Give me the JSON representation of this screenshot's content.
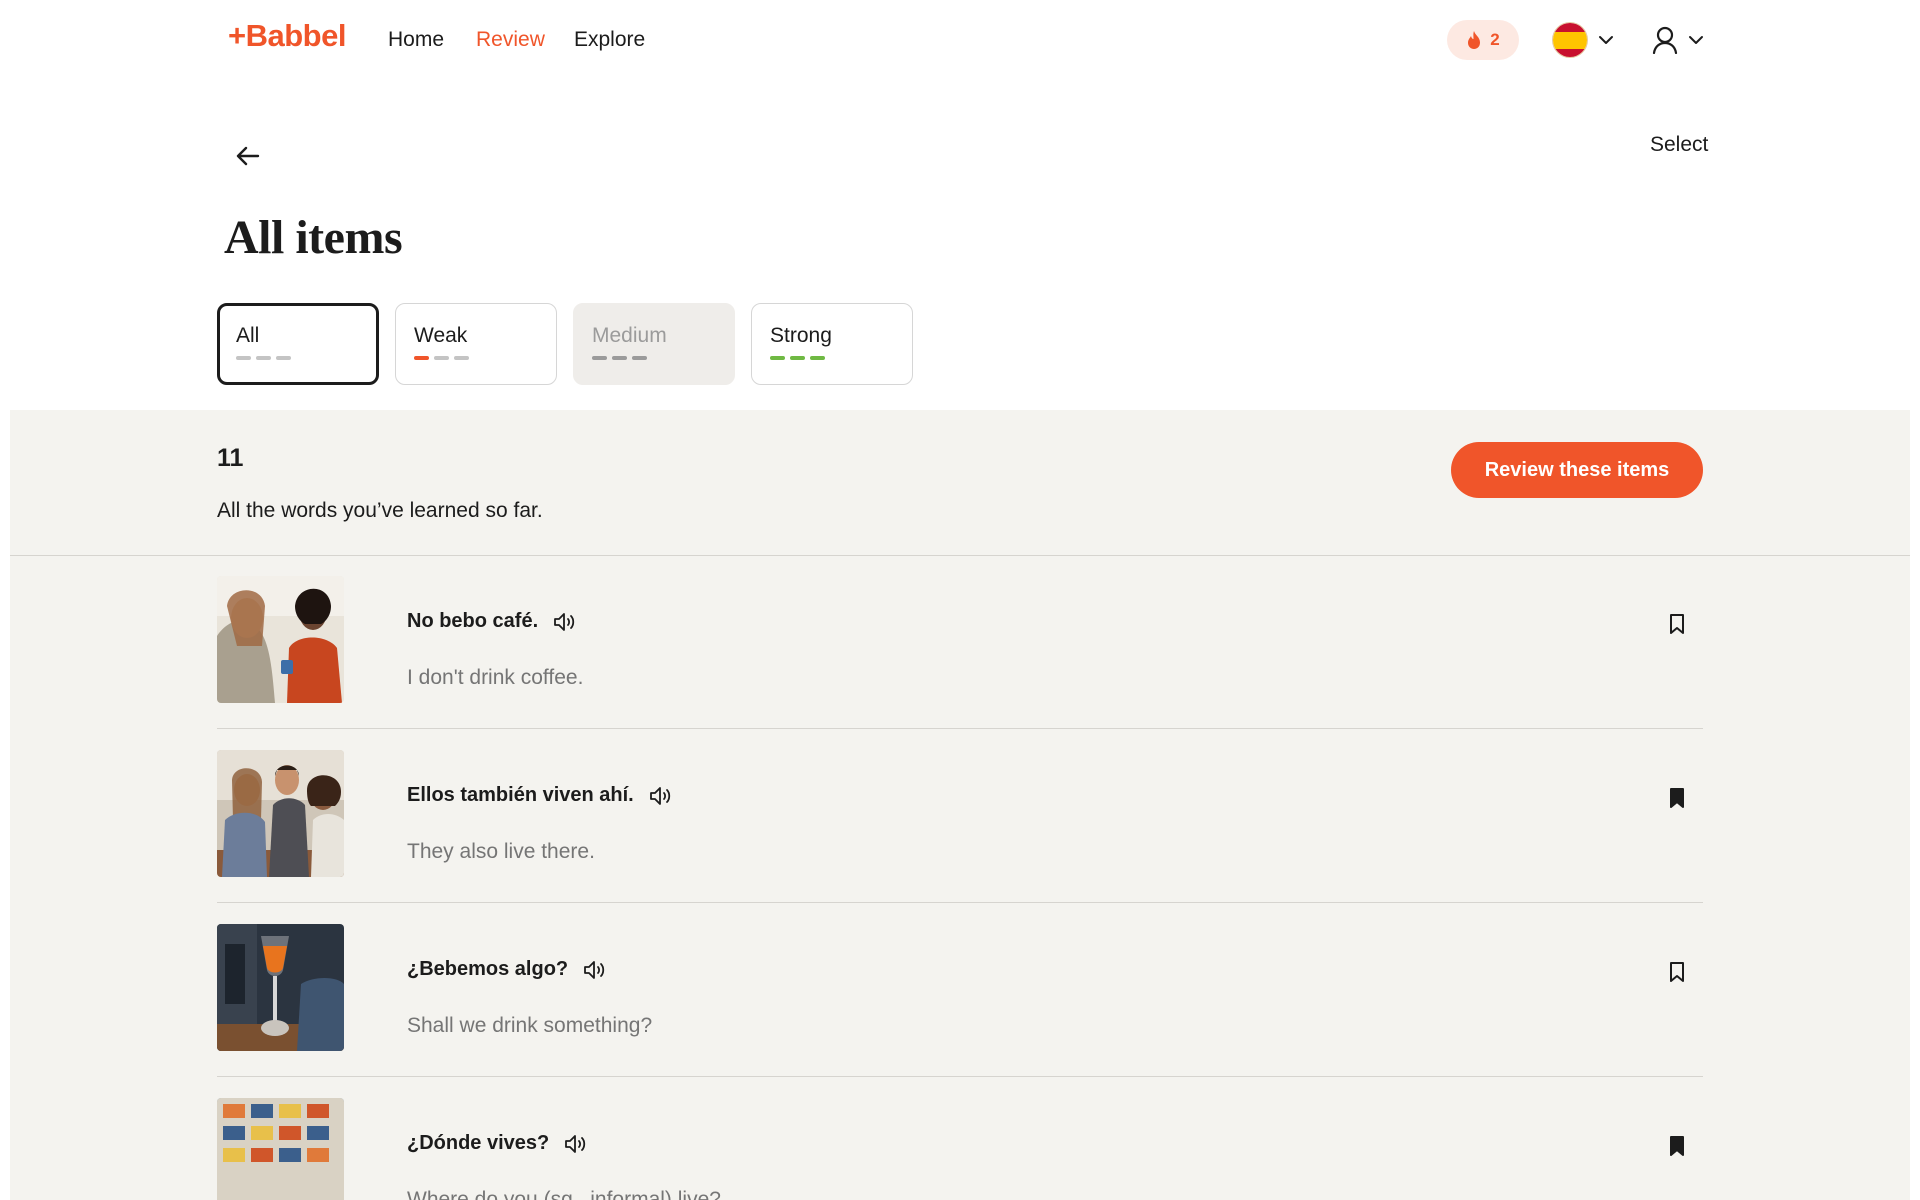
{
  "header": {
    "logo": "+Babbel",
    "nav": [
      {
        "label": "Home",
        "active": false
      },
      {
        "label": "Review",
        "active": true
      },
      {
        "label": "Explore",
        "active": false
      }
    ],
    "streak_count": "2",
    "language_flag": "spain-flag-icon",
    "accent_color": "#f0552a"
  },
  "page": {
    "select_label": "Select",
    "title": "All items"
  },
  "filters": [
    {
      "label": "All",
      "state": "selected",
      "dashes": [
        "gray",
        "gray",
        "gray"
      ]
    },
    {
      "label": "Weak",
      "state": "normal",
      "dashes": [
        "orange",
        "gray",
        "gray"
      ]
    },
    {
      "label": "Medium",
      "state": "disabled",
      "dashes": [
        "gray",
        "gray",
        "gray"
      ]
    },
    {
      "label": "Strong",
      "state": "normal",
      "dashes": [
        "green",
        "green",
        "green"
      ]
    }
  ],
  "summary": {
    "count": "11",
    "description": "All the words you’ve learned so far.",
    "review_button": "Review these items"
  },
  "items": [
    {
      "phrase": "No bebo café.",
      "translation": "I don't drink coffee.",
      "bookmarked": false
    },
    {
      "phrase": "Ellos también viven ahí.",
      "translation": "They also live there.",
      "bookmarked": true
    },
    {
      "phrase": "¿Bebemos algo?",
      "translation": "Shall we drink something?",
      "bookmarked": false
    },
    {
      "phrase": "¿Dónde vives?",
      "translation": "Where do you (sg., informal) live?",
      "bookmarked": true
    }
  ]
}
